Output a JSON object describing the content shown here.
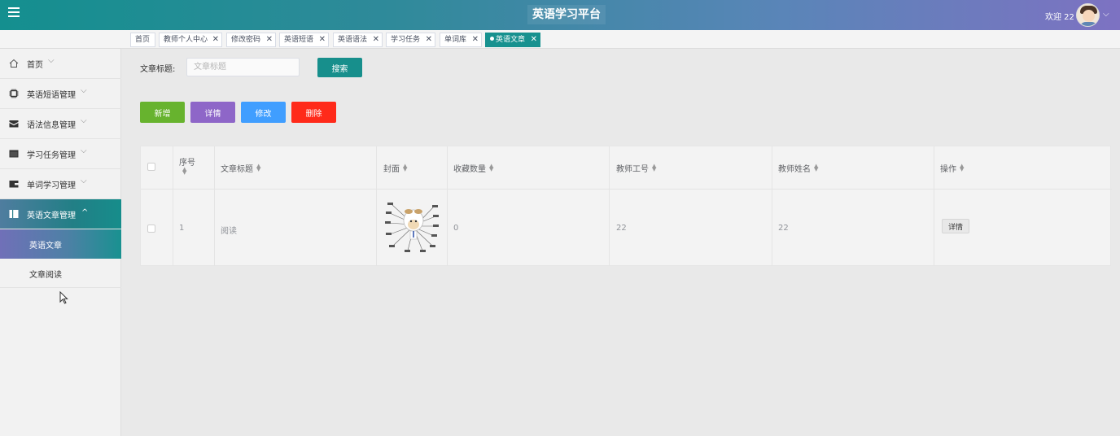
{
  "header": {
    "title": "英语学习平台",
    "welcome": "欢迎 22"
  },
  "tabs": [
    {
      "label": "首页",
      "closable": false
    },
    {
      "label": "教师个人中心",
      "closable": true
    },
    {
      "label": "修改密码",
      "closable": true
    },
    {
      "label": "英语短语",
      "closable": true
    },
    {
      "label": "英语语法",
      "closable": true
    },
    {
      "label": "学习任务",
      "closable": true
    },
    {
      "label": "单词库",
      "closable": true
    },
    {
      "label": "英语文章",
      "closable": true,
      "active": true
    }
  ],
  "sidebar": {
    "items": [
      {
        "label": "首页",
        "icon": "home-icon"
      },
      {
        "label": "英语短语管理",
        "icon": "chip-icon"
      },
      {
        "label": "语法信息管理",
        "icon": "envelope-icon"
      },
      {
        "label": "学习任务管理",
        "icon": "window-icon"
      },
      {
        "label": "单词学习管理",
        "icon": "wallet-icon"
      },
      {
        "label": "英语文章管理",
        "icon": "book-icon",
        "expanded": true
      }
    ],
    "subitems": [
      {
        "label": "英语文章",
        "active": true
      },
      {
        "label": "文章阅读"
      }
    ]
  },
  "search": {
    "label": "文章标题:",
    "placeholder": "文章标题",
    "value": "",
    "button": "搜索"
  },
  "actions": {
    "add": "新增",
    "detail": "详情",
    "edit": "修改",
    "delete": "删除"
  },
  "colors": {
    "primary": "#178f8c",
    "add": "#67b32e",
    "detail": "#8e66c8",
    "edit": "#409eff",
    "delete": "#ff2a1a"
  },
  "table": {
    "headers": {
      "index": "序号",
      "title": "文章标题",
      "cover": "封面",
      "favorites": "收藏数量",
      "teacher_id": "教师工号",
      "teacher_name": "教师姓名",
      "operation": "操作"
    },
    "rows": [
      {
        "index": "1",
        "title": "阅读",
        "favorites": "0",
        "teacher_id": "22",
        "teacher_name": "22",
        "detail_button": "详情"
      }
    ]
  }
}
